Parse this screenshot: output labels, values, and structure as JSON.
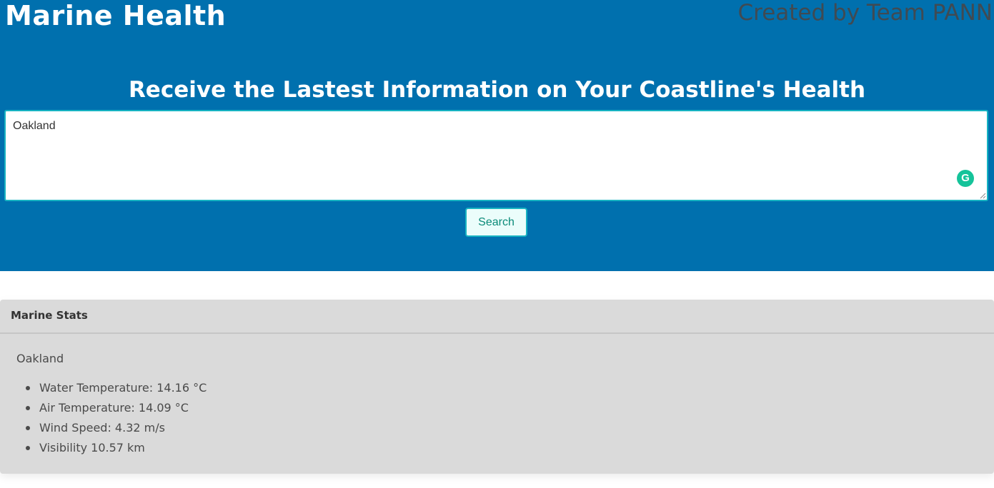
{
  "header": {
    "brand": "Marine Health",
    "credit": "Created by Team PANN",
    "tagline": "Receive the Lastest Information on Your Coastline's Health"
  },
  "search": {
    "value": "Oakland",
    "button_label": "Search",
    "extension_icon": "grammarly-icon",
    "extension_glyph": "G"
  },
  "stats_card": {
    "title": "Marine Stats",
    "location": "Oakland",
    "items": [
      "Water Temperature: 14.16 °C",
      "Air Temperature: 14.09 °C",
      "Wind Speed: 4.32 m/s",
      "Visibility 10.57 km"
    ]
  },
  "colors": {
    "hero_background": "#0070ae",
    "accent_border": "#17b3c2",
    "button_text": "#0a8a78",
    "card_background": "#dadada",
    "grammarly": "#15c39a"
  }
}
